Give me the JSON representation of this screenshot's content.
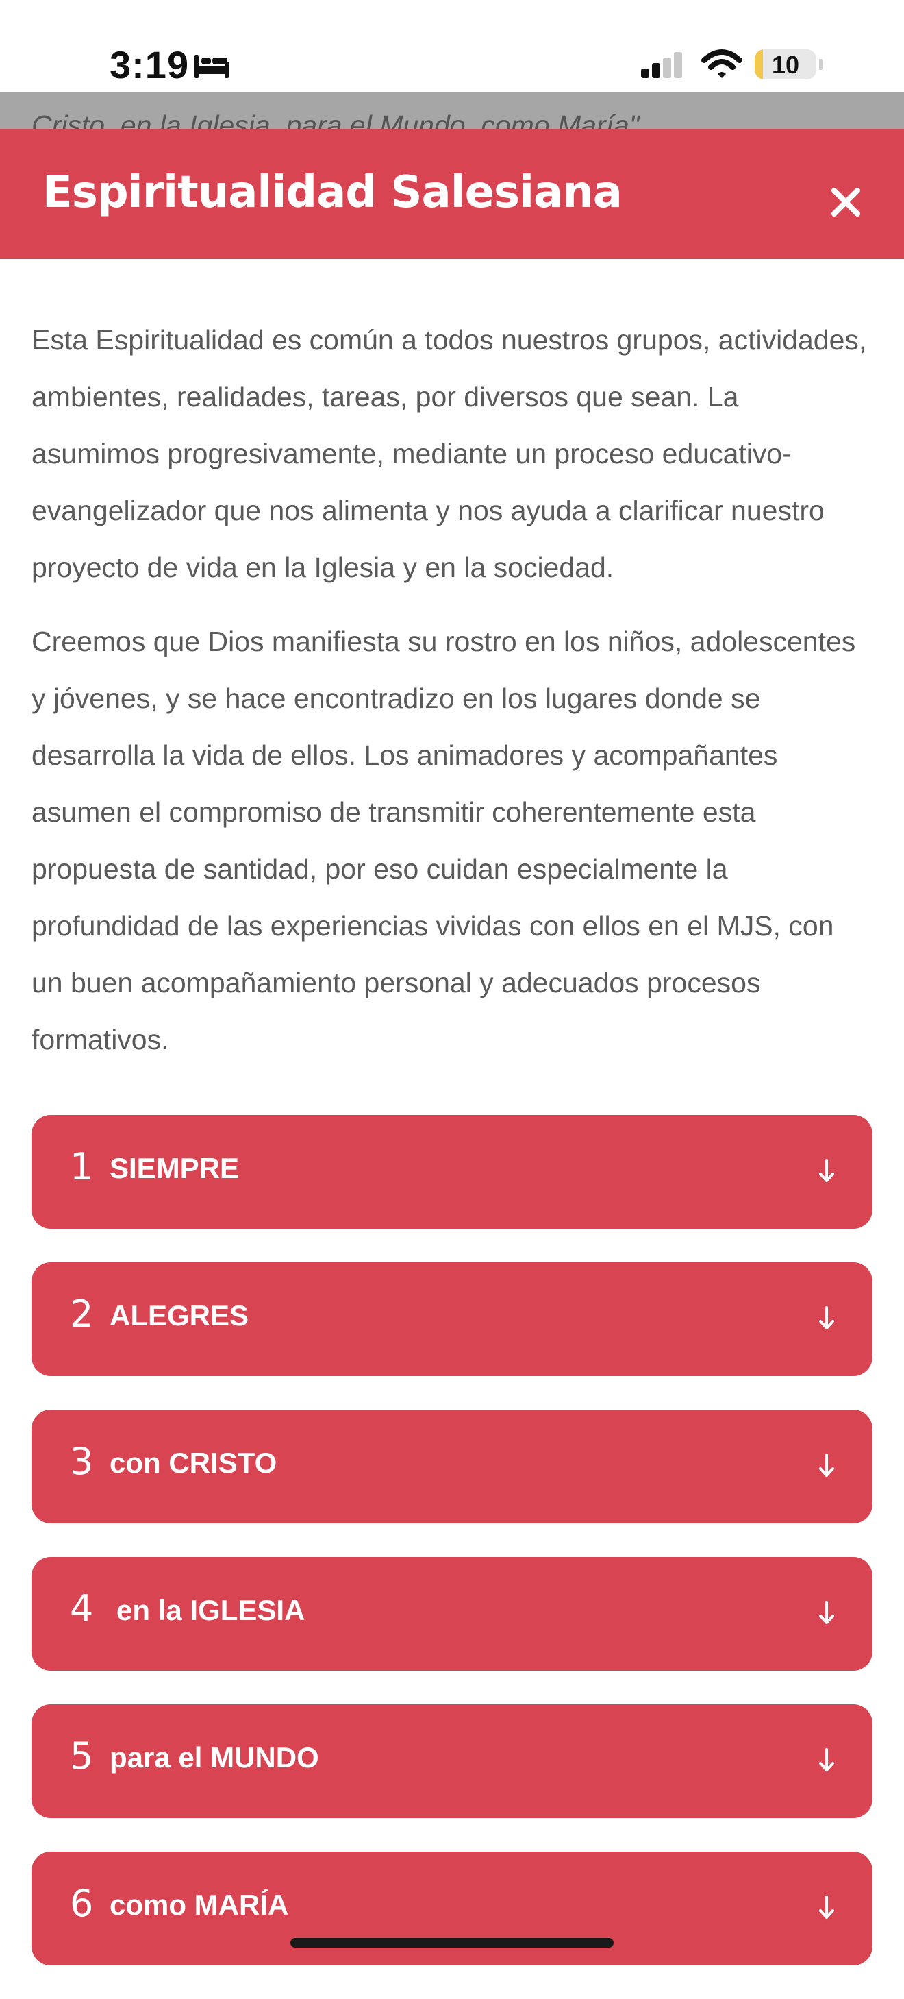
{
  "status_bar": {
    "time": "3:19",
    "battery": "10",
    "icons": [
      "bed-icon",
      "cellular-signal-icon",
      "wifi-icon",
      "battery-icon"
    ]
  },
  "header": {
    "title": "Espiritualidad Salesiana",
    "close_icon": "close-icon"
  },
  "content": {
    "prev_line": "Cristo, en la Iglesia, para el Mundo, como María\".",
    "paragraph_1": "Esta Espiritualidad es común a todos nuestros grupos, actividades, ambientes, realidades, tareas, por diversos que sean. La asumimos progresivamente, mediante un proceso educativo-evangelizador que nos alimenta y nos ayuda a clarificar nuestro proyecto de vida en la Iglesia y en la sociedad.",
    "paragraph_2": "Creemos que Dios manifiesta su rostro en los niños, adolescentes y jóvenes, y se hace encontradizo en los lugares donde se desarrolla la vida de ellos. Los animadores y acompañantes asumen el compromiso de transmitir coherentemente esta propuesta de santidad, por eso cuidan especialmente la profundidad de las experiencias vividas con ellos en el MJS, con un buen acompañamiento personal y adecuados procesos formativos."
  },
  "accordion": [
    {
      "number": "1",
      "label": "SIEMPRE"
    },
    {
      "number": "2",
      "label": "ALEGRES"
    },
    {
      "number": "3",
      "label": "con CRISTO"
    },
    {
      "number": "4",
      "label": "en la IGLESIA"
    },
    {
      "number": "5",
      "label": "para el MUNDO"
    },
    {
      "number": "6",
      "label": "como MARÍA"
    }
  ],
  "colors": {
    "accent": "#d94452",
    "text": "#5a5a5a",
    "strip": "#a6a6a6"
  }
}
